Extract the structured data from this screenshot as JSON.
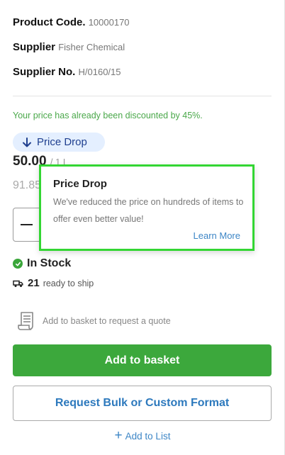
{
  "specs": {
    "product_code_label": "Product Code.",
    "product_code_value": "10000170",
    "supplier_label": "Supplier",
    "supplier_value": "Fisher Chemical",
    "supplier_no_label": "Supplier No.",
    "supplier_no_value": "H/0160/15"
  },
  "discount_note": "Your price has already been discounted by 45%.",
  "price_drop_badge": {
    "icon": "arrow-down-icon",
    "label": "Price Drop"
  },
  "price": {
    "current": "50.00",
    "unit_fragment": "/ 1 L",
    "old": "91.85"
  },
  "tooltip": {
    "title": "Price Drop",
    "body": "We've reduced the price on hundreds of items to offer even better value!",
    "link": "Learn More"
  },
  "stock": {
    "status": "In Stock",
    "ship_count": "21",
    "ship_text": "ready to ship"
  },
  "quote_note": "Add to basket to request a quote",
  "buttons": {
    "add_to_basket": "Add to basket",
    "bulk": "Request Bulk or Custom Format",
    "add_to_list": "Add to List"
  },
  "colors": {
    "accent_green": "#3ca83c",
    "link_blue": "#2d79bd",
    "tooltip_border": "#33d633",
    "badge_bg": "#e4efff"
  }
}
